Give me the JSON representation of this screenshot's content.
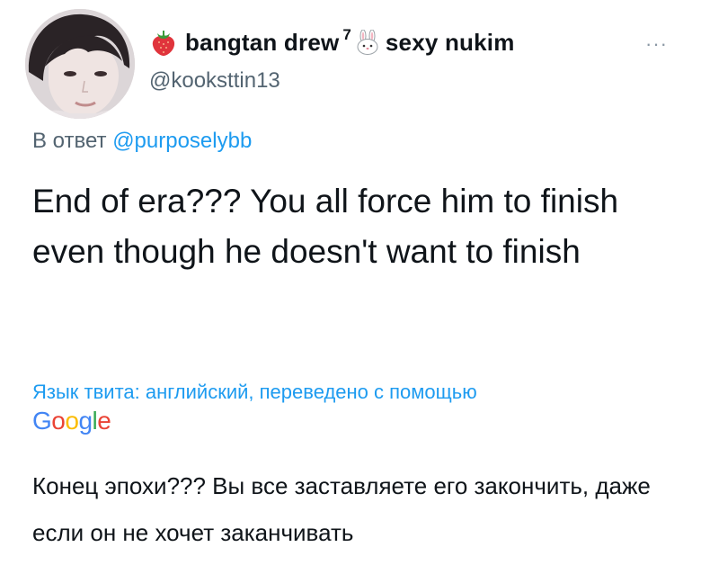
{
  "author": {
    "display_name": "bangtan drew",
    "superscript": "7",
    "display_name_suffix": "sexy nukim",
    "handle": "@kooksttin13",
    "name_emojis": [
      "strawberry-icon",
      "rabbit-icon"
    ]
  },
  "reply": {
    "prefix": "В ответ",
    "mention": "@purposelybb"
  },
  "tweet": {
    "text": "End of era??? You all force him to finish even though he doesn't want to finish"
  },
  "translation": {
    "info": "Язык твита: английский, переведено с помощью",
    "provider_letters": [
      "G",
      "o",
      "o",
      "g",
      "l",
      "e"
    ],
    "provider_colors": [
      "#4285f4",
      "#ea4335",
      "#fbbc05",
      "#4285f4",
      "#34a853",
      "#ea4335"
    ],
    "text": "Конец эпохи??? Вы все заставляете его закончить, даже если он не хочет заканчивать"
  },
  "more_glyph": "···",
  "colors": {
    "link": "#1d9bf0",
    "secondary": "#536471",
    "primary_text": "#0f1419"
  }
}
